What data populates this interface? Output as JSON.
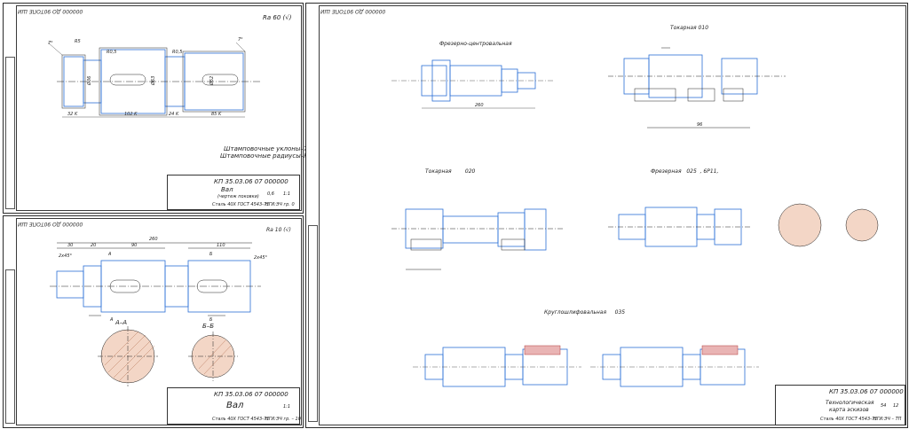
{
  "sheet1": {
    "corner_code": "000000 ДО 90ТОПЕ ШИ",
    "roughness": "Ra 60 (√)",
    "note1": "Штамповочные уклоны–7°",
    "note2": "Штамповочные радиусы–R 3",
    "title_code": "КП 35.03.06 07 000000",
    "part_name": "Вал",
    "part_sub": "(чертеж поковки)",
    "material": "Сталь 40Х ГОСТ 4543-71",
    "group": "НГИ:ЭЧ гр. 0",
    "mass": "0,6",
    "scale": "1:1"
  },
  "sheet2": {
    "corner_code": "000000 ДО 90ТОПЕ ШИ",
    "roughness": "Ra 10 (√)",
    "overall_length": "260",
    "title_code": "КП 35.03.06 07 000000",
    "part_name": "Вал",
    "material": "Сталь 40Х ГОСТ 4543-71",
    "group": "НГИ:ЭЧ гр. – 10",
    "scale": "1:1",
    "section_a": "А–А",
    "section_b": "Б–Б"
  },
  "sheet3": {
    "corner_code": "000000 ДО 90ТОПЕ ШИ",
    "op1": "Фрезерно-центровальная",
    "op2": "Токарная 010",
    "op3": "Токарная",
    "op3_num": "020",
    "op4": "Фрезерная",
    "op4_num": "025",
    "op4_ext": ", 6Р11,",
    "op5": "Круглошлифовальная",
    "op5_num": "035",
    "title_code": "КП 35.03.06 07 000000",
    "doc_name1": "Технологическая",
    "doc_name2": "карта эскизов",
    "material": "Сталь 40Х ГОСТ 4543-71",
    "group": "НГИ:ЭЧ – ТП",
    "sheet_a": "54",
    "sheet_b": "12",
    "dim_260": "260",
    "dim_96": "96"
  }
}
